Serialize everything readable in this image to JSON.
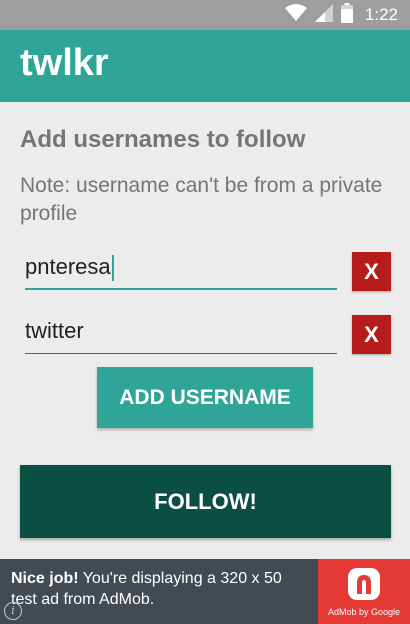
{
  "status_bar": {
    "time": "1:22",
    "icons": [
      "wifi-icon",
      "signal-icon",
      "battery-icon"
    ]
  },
  "app_bar": {
    "title": "twlkr"
  },
  "main": {
    "heading": "Add usernames to follow",
    "note": "Note: username can't be from a private profile",
    "usernames": [
      {
        "value": "pnteresa",
        "focused": true,
        "remove_label": "X"
      },
      {
        "value": "twitter",
        "focused": false,
        "remove_label": "X"
      }
    ],
    "add_button_label": "ADD USERNAME",
    "follow_button_label": "FOLLOW!"
  },
  "ad": {
    "bold_text": "Nice job!",
    "text": " You're displaying a 320 x 50 test ad from AdMob.",
    "badge_text": "AdMob by Google",
    "info_label": "i"
  },
  "colors": {
    "accent": "#2ea596",
    "dark_accent": "#0b4f43",
    "remove": "#b71c1c",
    "ad_badge": "#e53935"
  }
}
